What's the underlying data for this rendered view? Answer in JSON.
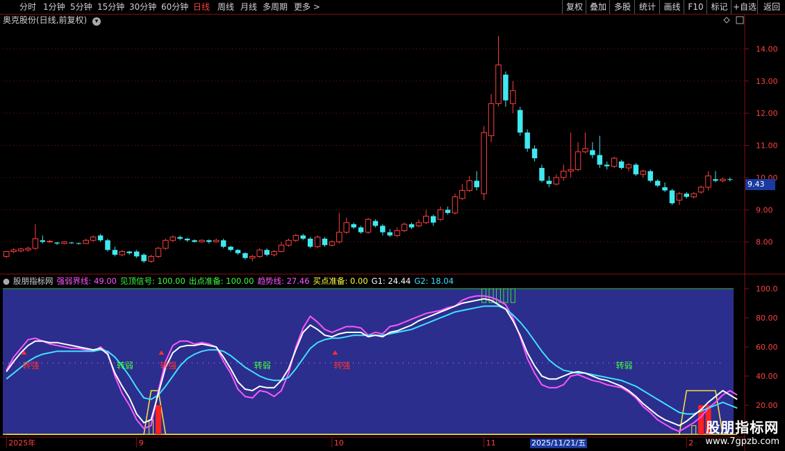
{
  "toolbar": {
    "periods": [
      "分时",
      "1分钟",
      "5分钟",
      "15分钟",
      "30分钟",
      "60分钟",
      "日线",
      "周线",
      "月线",
      "多周期",
      "更多 >"
    ],
    "active_period": "日线",
    "right_buttons": [
      "复权",
      "叠加",
      "多股",
      "统计",
      "画线",
      "F10",
      "标记",
      "+自选",
      "返回"
    ]
  },
  "stock_title": "奥克股份(日线,前复权)",
  "current_price_tag": "9.43",
  "indicator": {
    "name": "股朋指标网",
    "items": [
      {
        "label": "强弱界线: 49.00",
        "color": "#ff55ff"
      },
      {
        "label": "见顶信号: 100.00",
        "color": "#40ff40"
      },
      {
        "label": "出点准备: 100.00",
        "color": "#40ff40"
      },
      {
        "label": "趋势线: 27.46",
        "color": "#ff55ff"
      },
      {
        "label": "买点准备: 0.00",
        "color": "#ffff40"
      },
      {
        "label": "G1: 24.44",
        "color": "#ffffff"
      },
      {
        "label": "G2: 18.04",
        "color": "#40e0ff"
      }
    ],
    "annotations": [
      {
        "text": "转强",
        "idx": 3,
        "color": "#ff3030"
      },
      {
        "text": "转弱",
        "idx": 16,
        "color": "#40ff40"
      },
      {
        "text": "转强",
        "idx": 22,
        "color": "#ff3030"
      },
      {
        "text": "转弱",
        "idx": 35,
        "color": "#40ff40"
      },
      {
        "text": "转强",
        "idx": 46,
        "color": "#ff3030"
      },
      {
        "text": "转弱",
        "idx": 85,
        "color": "#40ff40"
      }
    ]
  },
  "x_axis": {
    "labels": [
      {
        "text": "2025年",
        "idx": 0
      },
      {
        "text": "9",
        "idx": 18
      },
      {
        "text": "10",
        "idx": 45
      },
      {
        "text": "11",
        "idx": 66
      },
      {
        "text": "2",
        "idx": 94
      }
    ],
    "date_tag": "2025/11/21/五"
  },
  "logo": {
    "line1": "股朋指标网",
    "line2": "www.7gpzb.com"
  },
  "chart_data": {
    "type": "candlestick",
    "price_axis": {
      "ticks": [
        "14.00",
        "13.00",
        "12.00",
        "11.00",
        "10.00",
        "9.00",
        "8.00"
      ],
      "ylim": [
        7.0,
        14.7
      ]
    },
    "indicator_axis": {
      "ticks": [
        "100.0",
        "80.00",
        "60.00",
        "40.00",
        "20.00"
      ],
      "ylim": [
        0,
        100
      ]
    },
    "candles": [
      [
        7.55,
        7.7,
        7.5,
        7.72
      ],
      [
        7.7,
        7.75,
        7.65,
        7.8
      ],
      [
        7.72,
        7.78,
        7.68,
        7.82
      ],
      [
        7.75,
        7.8,
        7.7,
        7.85
      ],
      [
        7.8,
        8.1,
        7.75,
        8.55
      ],
      [
        8.05,
        8.0,
        7.95,
        8.2
      ],
      [
        8.0,
        8.02,
        7.98,
        8.06
      ],
      [
        7.98,
        7.95,
        7.9,
        8.0
      ],
      [
        7.95,
        8.0,
        7.92,
        8.02
      ],
      [
        7.98,
        7.96,
        7.94,
        8.0
      ],
      [
        7.96,
        7.94,
        7.92,
        7.98
      ],
      [
        7.95,
        8.05,
        7.94,
        8.1
      ],
      [
        8.05,
        8.15,
        8.0,
        8.2
      ],
      [
        8.2,
        8.05,
        8.0,
        8.25
      ],
      [
        8.05,
        7.75,
        7.7,
        8.1
      ],
      [
        7.75,
        7.6,
        7.55,
        7.85
      ],
      [
        7.6,
        7.7,
        7.55,
        7.75
      ],
      [
        7.7,
        7.65,
        7.6,
        7.72
      ],
      [
        7.7,
        7.55,
        7.5,
        7.75
      ],
      [
        7.6,
        7.4,
        7.35,
        7.65
      ],
      [
        7.4,
        7.55,
        7.35,
        7.6
      ],
      [
        7.55,
        7.8,
        7.5,
        7.85
      ],
      [
        7.8,
        8.05,
        7.75,
        8.1
      ],
      [
        8.05,
        8.15,
        8.0,
        8.2
      ],
      [
        8.15,
        8.1,
        8.05,
        8.2
      ],
      [
        8.1,
        8.05,
        8.0,
        8.12
      ],
      [
        8.05,
        8.0,
        7.98,
        8.08
      ],
      [
        8.0,
        8.05,
        7.98,
        8.08
      ],
      [
        8.05,
        8.0,
        7.95,
        8.08
      ],
      [
        8.0,
        8.05,
        7.98,
        8.1
      ],
      [
        8.05,
        7.85,
        7.8,
        8.1
      ],
      [
        7.85,
        7.75,
        7.7,
        7.88
      ],
      [
        7.75,
        7.65,
        7.6,
        7.78
      ],
      [
        7.65,
        7.5,
        7.45,
        7.68
      ],
      [
        7.5,
        7.55,
        7.4,
        7.6
      ],
      [
        7.55,
        7.75,
        7.5,
        7.8
      ],
      [
        7.75,
        7.6,
        7.55,
        7.8
      ],
      [
        7.6,
        7.7,
        7.55,
        7.75
      ],
      [
        7.7,
        7.9,
        7.68,
        8.0
      ],
      [
        7.9,
        8.05,
        7.85,
        8.1
      ],
      [
        8.05,
        8.2,
        8.0,
        8.25
      ],
      [
        8.2,
        8.1,
        8.05,
        8.25
      ],
      [
        8.1,
        7.85,
        7.8,
        8.15
      ],
      [
        7.85,
        8.15,
        7.8,
        8.2
      ],
      [
        8.1,
        7.9,
        7.85,
        8.15
      ],
      [
        7.9,
        8.0,
        7.85,
        8.05
      ],
      [
        8.0,
        8.3,
        7.95,
        8.9
      ],
      [
        8.3,
        8.6,
        8.25,
        8.75
      ],
      [
        8.55,
        8.45,
        8.4,
        8.6
      ],
      [
        8.45,
        8.3,
        8.25,
        8.5
      ],
      [
        8.3,
        8.7,
        8.25,
        8.75
      ],
      [
        8.65,
        8.5,
        8.45,
        8.7
      ],
      [
        8.5,
        8.3,
        8.2,
        8.55
      ],
      [
        8.3,
        8.2,
        8.15,
        8.4
      ],
      [
        8.2,
        8.35,
        8.15,
        8.45
      ],
      [
        8.35,
        8.55,
        8.3,
        8.6
      ],
      [
        8.55,
        8.45,
        8.4,
        8.6
      ],
      [
        8.5,
        8.6,
        8.45,
        8.7
      ],
      [
        8.6,
        8.8,
        8.55,
        9.0
      ],
      [
        8.8,
        8.6,
        8.5,
        8.85
      ],
      [
        8.7,
        9.0,
        8.65,
        9.1
      ],
      [
        9.0,
        8.9,
        8.85,
        9.1
      ],
      [
        8.9,
        9.4,
        8.85,
        9.5
      ],
      [
        9.35,
        9.6,
        9.3,
        9.8
      ],
      [
        9.6,
        9.9,
        9.55,
        10.05
      ],
      [
        9.9,
        9.7,
        9.6,
        10.2
      ],
      [
        9.5,
        11.4,
        9.3,
        11.6
      ],
      [
        11.3,
        12.3,
        11.1,
        12.6
      ],
      [
        12.3,
        13.5,
        12.2,
        14.4
      ],
      [
        13.2,
        12.4,
        12.2,
        13.3
      ],
      [
        12.3,
        12.7,
        12.0,
        13.0
      ],
      [
        12.1,
        11.4,
        11.3,
        12.2
      ],
      [
        11.4,
        10.9,
        10.8,
        11.5
      ],
      [
        10.9,
        10.6,
        10.5,
        11.0
      ],
      [
        10.3,
        9.9,
        9.85,
        10.4
      ],
      [
        9.9,
        9.8,
        9.7,
        10.05
      ],
      [
        9.8,
        10.0,
        9.75,
        10.1
      ],
      [
        10.0,
        10.2,
        9.9,
        10.4
      ],
      [
        10.2,
        10.25,
        10.0,
        11.4
      ],
      [
        10.25,
        10.8,
        10.2,
        11.1
      ],
      [
        10.8,
        10.9,
        10.75,
        11.4
      ],
      [
        10.85,
        10.7,
        10.6,
        11.1
      ],
      [
        10.7,
        10.4,
        10.3,
        11.3
      ],
      [
        10.4,
        10.35,
        10.25,
        10.5
      ],
      [
        10.35,
        10.6,
        10.3,
        10.65
      ],
      [
        10.5,
        10.3,
        10.25,
        10.55
      ],
      [
        10.3,
        10.4,
        10.2,
        10.45
      ],
      [
        10.4,
        10.1,
        10.05,
        10.45
      ],
      [
        10.1,
        10.2,
        10.0,
        10.25
      ],
      [
        10.2,
        9.9,
        9.85,
        10.25
      ],
      [
        9.9,
        9.75,
        9.7,
        9.95
      ],
      [
        9.7,
        9.6,
        9.55,
        9.85
      ],
      [
        9.6,
        9.2,
        9.15,
        9.65
      ],
      [
        9.3,
        9.5,
        9.15,
        9.55
      ],
      [
        9.5,
        9.4,
        9.35,
        9.55
      ],
      [
        9.4,
        9.5,
        9.35,
        9.55
      ],
      [
        9.55,
        9.7,
        9.5,
        9.75
      ],
      [
        9.7,
        10.05,
        9.6,
        10.2
      ],
      [
        9.95,
        9.9,
        9.85,
        10.2
      ],
      [
        9.9,
        9.95,
        9.85,
        10.0
      ],
      [
        9.95,
        9.93,
        9.88,
        10.0
      ]
    ],
    "series": [
      {
        "name": "G1",
        "color": "#ffffff",
        "values": [
          43,
          50,
          56,
          61,
          64,
          64,
          63,
          63,
          62,
          61,
          60,
          59,
          58,
          59,
          55,
          42,
          33,
          25,
          14,
          8,
          10,
          28,
          46,
          56,
          60,
          61,
          61,
          62,
          61,
          60,
          53,
          45,
          36,
          31,
          30,
          33,
          32,
          32,
          37,
          45,
          58,
          70,
          75,
          72,
          68,
          67,
          69,
          70,
          70,
          70,
          67,
          68,
          67,
          70,
          71,
          73,
          75,
          78,
          80,
          82,
          84,
          86,
          88,
          90,
          91,
          92,
          93,
          92,
          89,
          86,
          78,
          68,
          56,
          47,
          40,
          38,
          38,
          40,
          42,
          43,
          42,
          40,
          38,
          37,
          35,
          33,
          30,
          26,
          21,
          17,
          13,
          10,
          8,
          6,
          9,
          13,
          17,
          22,
          26,
          30,
          27,
          24
        ]
      },
      {
        "name": "G2",
        "color": "#40e0ff",
        "values": [
          38,
          42,
          46,
          50,
          53,
          55,
          56,
          57,
          57,
          57,
          57,
          57,
          57,
          58,
          57,
          53,
          47,
          40,
          32,
          25,
          24,
          27,
          33,
          40,
          47,
          52,
          55,
          57,
          58,
          58,
          57,
          54,
          50,
          46,
          43,
          40,
          38,
          37,
          37,
          39,
          45,
          52,
          59,
          63,
          65,
          66,
          66,
          67,
          68,
          68,
          68,
          68,
          68,
          69,
          70,
          71,
          72,
          74,
          76,
          78,
          80,
          82,
          84,
          85,
          86,
          87,
          88,
          88,
          88,
          86,
          82,
          77,
          71,
          64,
          57,
          51,
          47,
          44,
          43,
          42,
          42,
          41,
          40,
          39,
          38,
          37,
          35,
          33,
          30,
          27,
          24,
          21,
          18,
          15,
          14,
          14,
          16,
          18,
          20,
          22,
          20,
          18
        ]
      },
      {
        "name": "强弱界线",
        "color": "#ff55ff",
        "values": [
          44,
          53,
          59,
          65,
          66,
          64,
          62,
          61,
          60,
          59,
          59,
          58,
          57,
          60,
          56,
          40,
          28,
          20,
          10,
          4,
          6,
          30,
          50,
          61,
          64,
          64,
          62,
          63,
          62,
          60,
          50,
          42,
          31,
          26,
          25,
          30,
          29,
          26,
          30,
          42,
          60,
          73,
          81,
          77,
          72,
          70,
          72,
          74,
          74,
          73,
          68,
          70,
          69,
          74,
          75,
          77,
          79,
          81,
          83,
          84,
          85,
          87,
          88,
          92,
          94,
          95,
          95,
          94,
          92,
          89,
          80,
          67,
          52,
          42,
          34,
          32,
          32,
          34,
          40,
          41,
          39,
          37,
          36,
          34,
          33,
          32,
          29,
          25,
          19,
          15,
          10,
          7,
          4,
          2,
          5,
          8,
          12,
          18,
          22,
          27,
          30,
          27
        ]
      }
    ],
    "yellow_line": [
      0,
      0,
      0,
      0,
      0,
      0,
      0,
      0,
      0,
      0,
      0,
      0,
      0,
      0,
      0,
      0,
      0,
      0,
      0,
      0,
      30,
      30,
      0,
      0,
      0,
      0,
      0,
      0,
      0,
      0,
      0,
      0,
      0,
      0,
      0,
      0,
      0,
      0,
      0,
      0,
      0,
      0,
      0,
      0,
      0,
      0,
      0,
      0,
      0,
      0,
      0,
      0,
      0,
      0,
      0,
      0,
      0,
      0,
      0,
      0,
      0,
      0,
      0,
      0,
      0,
      0,
      0,
      0,
      0,
      0,
      0,
      0,
      0,
      0,
      0,
      0,
      0,
      0,
      0,
      0,
      0,
      0,
      0,
      0,
      0,
      0,
      0,
      0,
      0,
      0,
      0,
      0,
      0,
      0,
      30,
      30,
      30,
      30,
      30,
      0,
      0,
      0
    ],
    "red_bars": [
      {
        "idx": 21,
        "h": 20
      },
      {
        "idx": 96,
        "h": 20
      },
      {
        "idx": 97,
        "h": 20
      }
    ],
    "hollow_bars": [
      {
        "idx": 20,
        "h": 10
      },
      {
        "idx": 95,
        "h": 6
      }
    ],
    "green_top_bars": [
      66,
      67,
      68,
      69,
      70
    ],
    "reference_line": 49,
    "reference_label": "强弱界线"
  }
}
